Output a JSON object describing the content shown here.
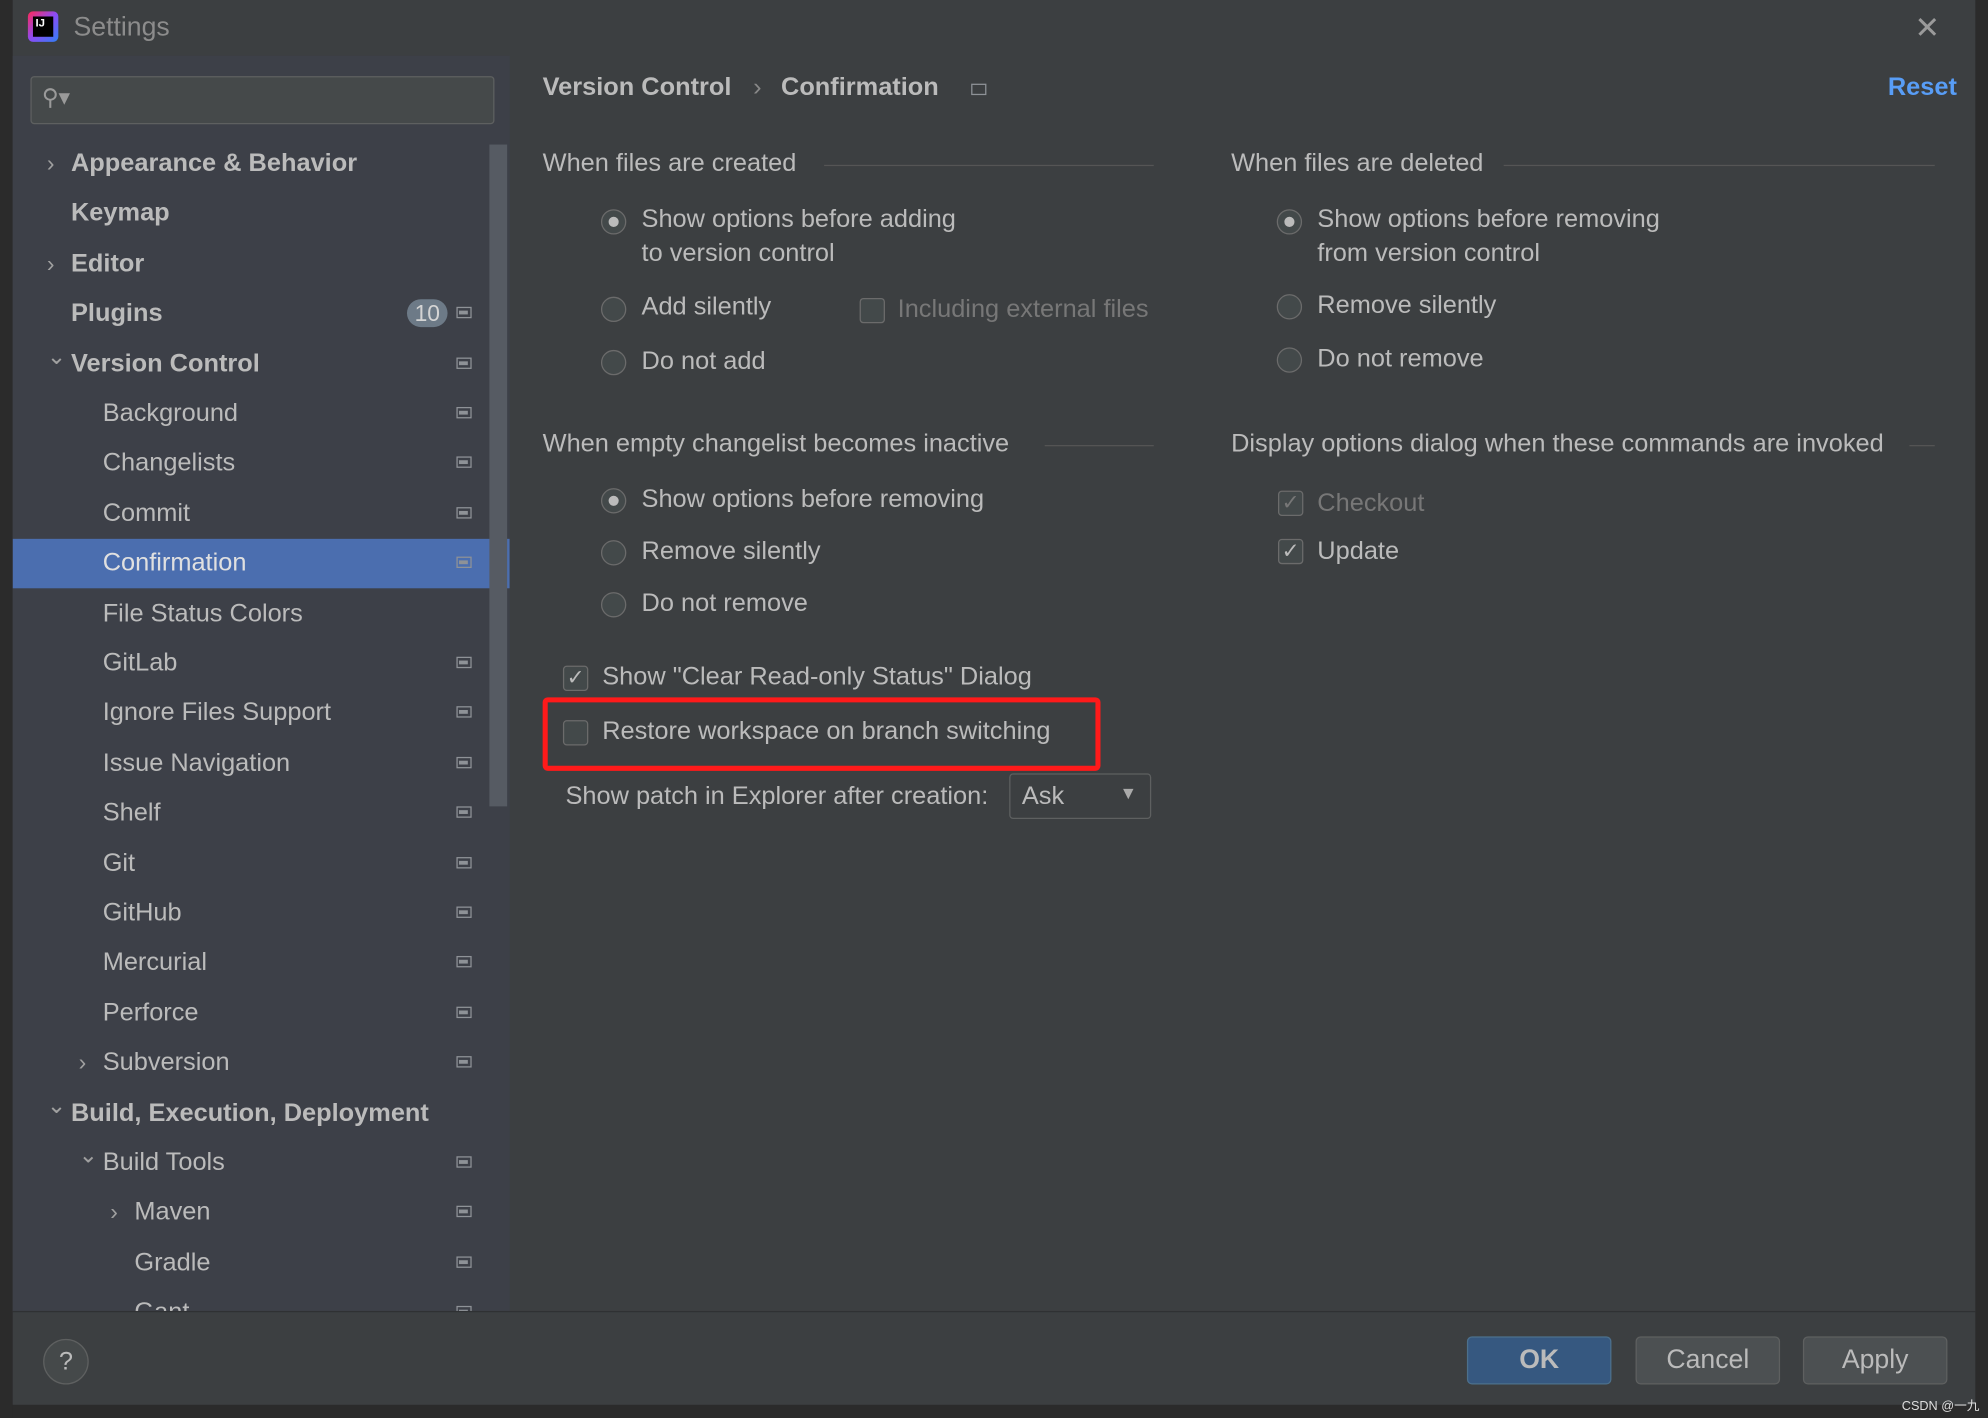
{
  "window": {
    "title": "Settings",
    "close_icon": "close-icon"
  },
  "search": {
    "placeholder": ""
  },
  "tree": [
    {
      "label": "Appearance & Behavior",
      "level": 0,
      "chevron": "right"
    },
    {
      "label": "Keymap",
      "level": 0
    },
    {
      "label": "Editor",
      "level": 0,
      "chevron": "right"
    },
    {
      "label": "Plugins",
      "level": 0,
      "badge": "10",
      "project": true
    },
    {
      "label": "Version Control",
      "level": 0,
      "chevron": "down",
      "project": true
    },
    {
      "label": "Background",
      "level": 1,
      "project": true
    },
    {
      "label": "Changelists",
      "level": 1,
      "project": true
    },
    {
      "label": "Commit",
      "level": 1,
      "project": true
    },
    {
      "label": "Confirmation",
      "level": 1,
      "project": true,
      "selected": true
    },
    {
      "label": "File Status Colors",
      "level": 1
    },
    {
      "label": "GitLab",
      "level": 1,
      "project": true
    },
    {
      "label": "Ignore Files Support",
      "level": 1,
      "project": true
    },
    {
      "label": "Issue Navigation",
      "level": 1,
      "project": true
    },
    {
      "label": "Shelf",
      "level": 1,
      "project": true
    },
    {
      "label": "Git",
      "level": 1,
      "project": true
    },
    {
      "label": "GitHub",
      "level": 1,
      "project": true
    },
    {
      "label": "Mercurial",
      "level": 1,
      "project": true
    },
    {
      "label": "Perforce",
      "level": 1,
      "project": true
    },
    {
      "label": "Subversion",
      "level": 1,
      "chevron": "right",
      "project": true
    },
    {
      "label": "Build, Execution, Deployment",
      "level": 0,
      "chevron": "down"
    },
    {
      "label": "Build Tools",
      "level": 1,
      "chevron": "down",
      "project": true
    },
    {
      "label": "Maven",
      "level": 2,
      "chevron": "right",
      "project": true
    },
    {
      "label": "Gradle",
      "level": 2,
      "project": true
    },
    {
      "label": "Gant",
      "level": 2,
      "project": true
    }
  ],
  "breadcrumb": {
    "parent": "Version Control",
    "current": "Confirmation",
    "reset": "Reset"
  },
  "created": {
    "title": "When files are created",
    "opt1a": "Show options before adding",
    "opt1b": "to version control",
    "opt2": "Add silently",
    "external": "Including external files",
    "opt3": "Do not add"
  },
  "deleted": {
    "title": "When files are deleted",
    "opt1a": "Show options before removing",
    "opt1b": "from version control",
    "opt2": "Remove silently",
    "opt3": "Do not remove"
  },
  "changelist": {
    "title": "When empty changelist becomes inactive",
    "opt1": "Show options before removing",
    "opt2": "Remove silently",
    "opt3": "Do not remove"
  },
  "commands": {
    "title": "Display options dialog when these commands are invoked",
    "checkout": "Checkout",
    "update": "Update"
  },
  "clear_readonly": "Show \"Clear Read-only Status\" Dialog",
  "restore_workspace": "Restore workspace on branch switching",
  "patch": {
    "label": "Show patch in Explorer after creation:",
    "value": "Ask"
  },
  "buttons": {
    "ok": "OK",
    "cancel": "Cancel",
    "apply": "Apply",
    "help": "?"
  },
  "watermark": "CSDN @一九",
  "colors": {
    "accent": "#4b6eaf",
    "highlight": "#ff1a1a",
    "ok_button": "#365880",
    "link": "#589df6"
  }
}
